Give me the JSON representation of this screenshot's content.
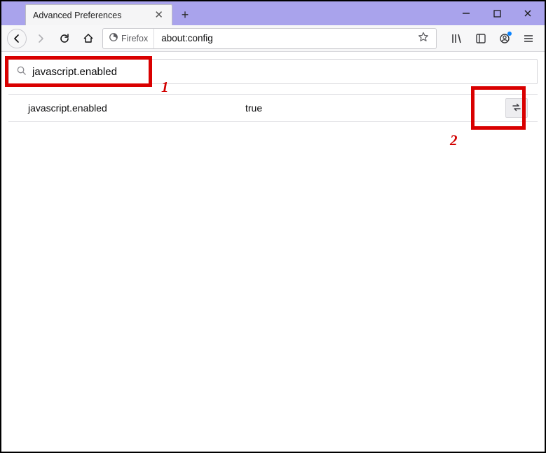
{
  "window": {
    "tab_title": "Advanced Preferences"
  },
  "urlbar": {
    "identity_label": "Firefox",
    "url": "about:config"
  },
  "config": {
    "search_value": "javascript.enabled",
    "row": {
      "name": "javascript.enabled",
      "value": "true"
    }
  },
  "annotations": {
    "one": "1",
    "two": "2"
  }
}
